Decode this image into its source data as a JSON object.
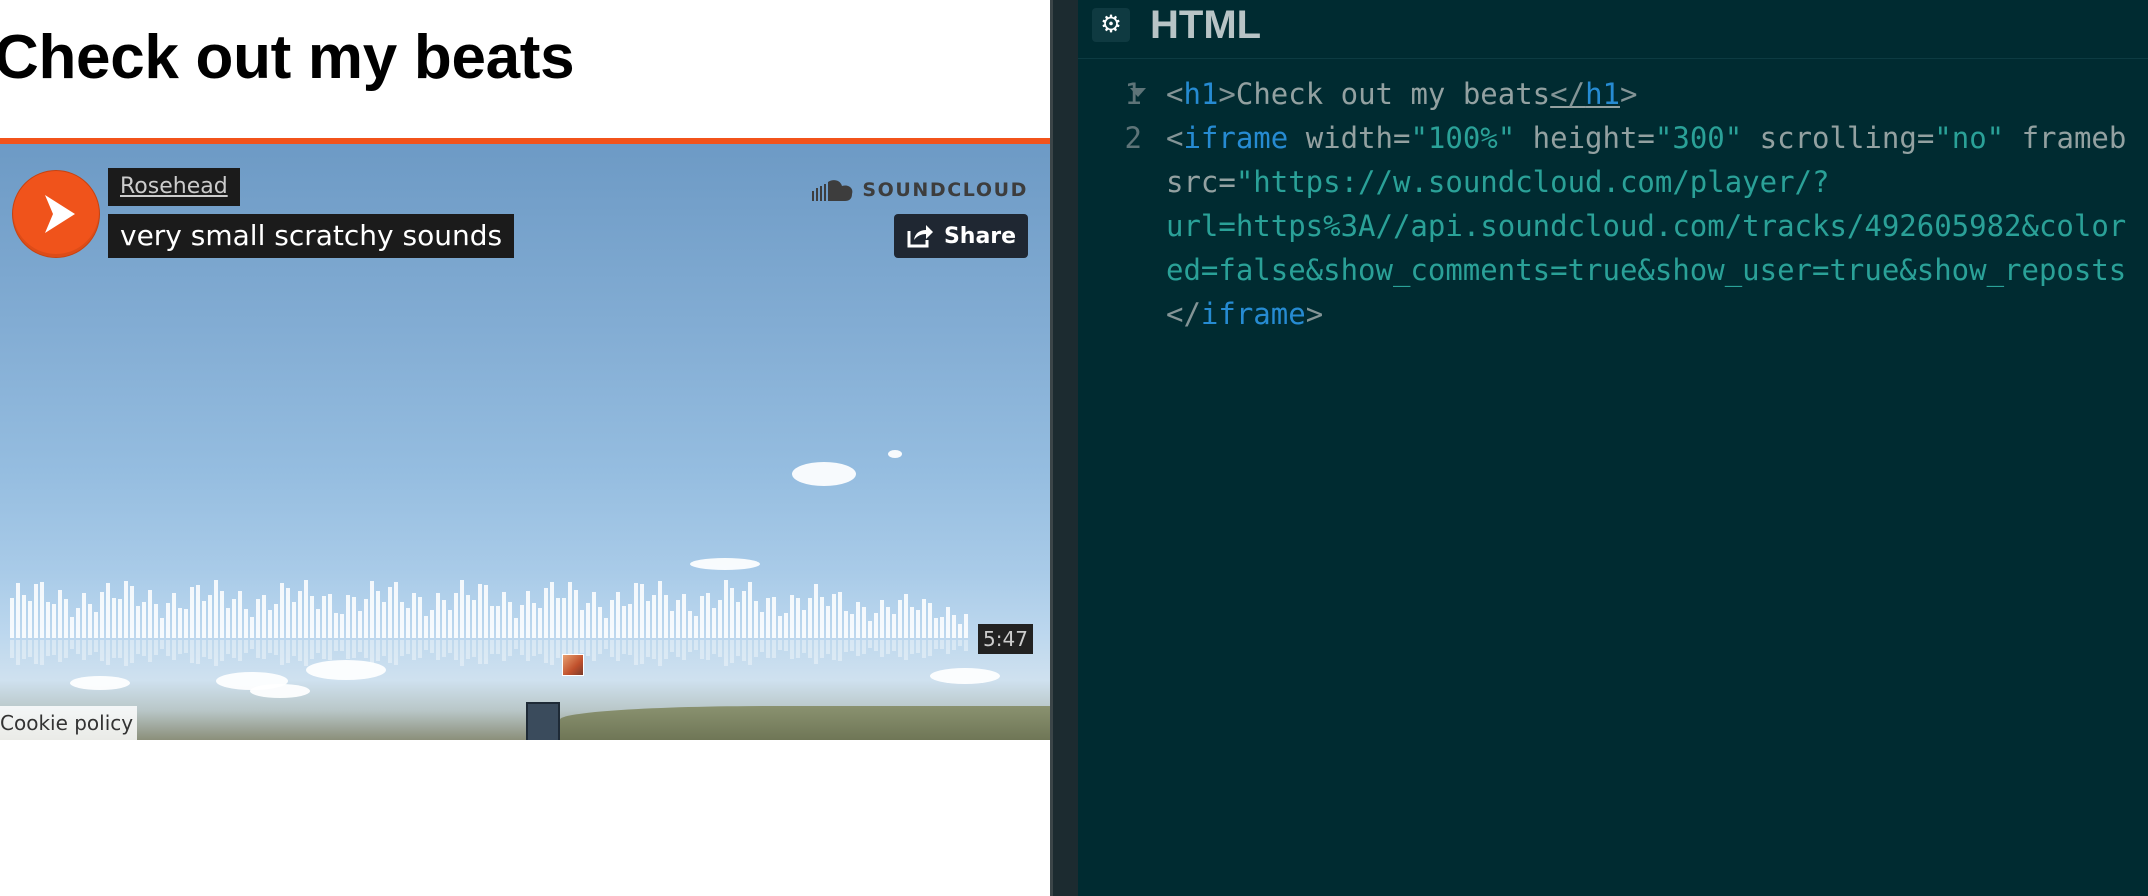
{
  "preview": {
    "heading": "Check out my beats",
    "player": {
      "username": "Rosehead",
      "track_title": "very small scratchy sounds",
      "brand": "SOUNDCLOUD",
      "share_label": "Share",
      "duration": "5:47",
      "cookie_policy": "Cookie policy",
      "accent_color": "#f2531b"
    }
  },
  "editor": {
    "title": "HTML",
    "settings_icon": "gear-icon",
    "line_numbers": [
      "1",
      "2"
    ],
    "code": {
      "l1_tag_open": "h1",
      "l1_text": "Check out my beats",
      "l1_tag_close": "h1",
      "l2_tag": "iframe",
      "l2_attr_width": " width=",
      "l2_val_width": "\"100%\"",
      "l2_attr_height": " height=",
      "l2_val_height": "\"300\"",
      "l2_attr_scrolling": " scrolling=",
      "l2_val_scrolling": "\"no\"",
      "l2_attr_frame": " frameb",
      "l3_attr_src": "src=",
      "l3_val": "\"https://w.soundcloud.com/player/?",
      "l4_val": "url=https%3A//api.soundcloud.com/tracks/492605982&color",
      "l5_val": "ed=false&show_comments=true&show_user=true&show_reposts",
      "l6_tag_close": "iframe"
    }
  }
}
